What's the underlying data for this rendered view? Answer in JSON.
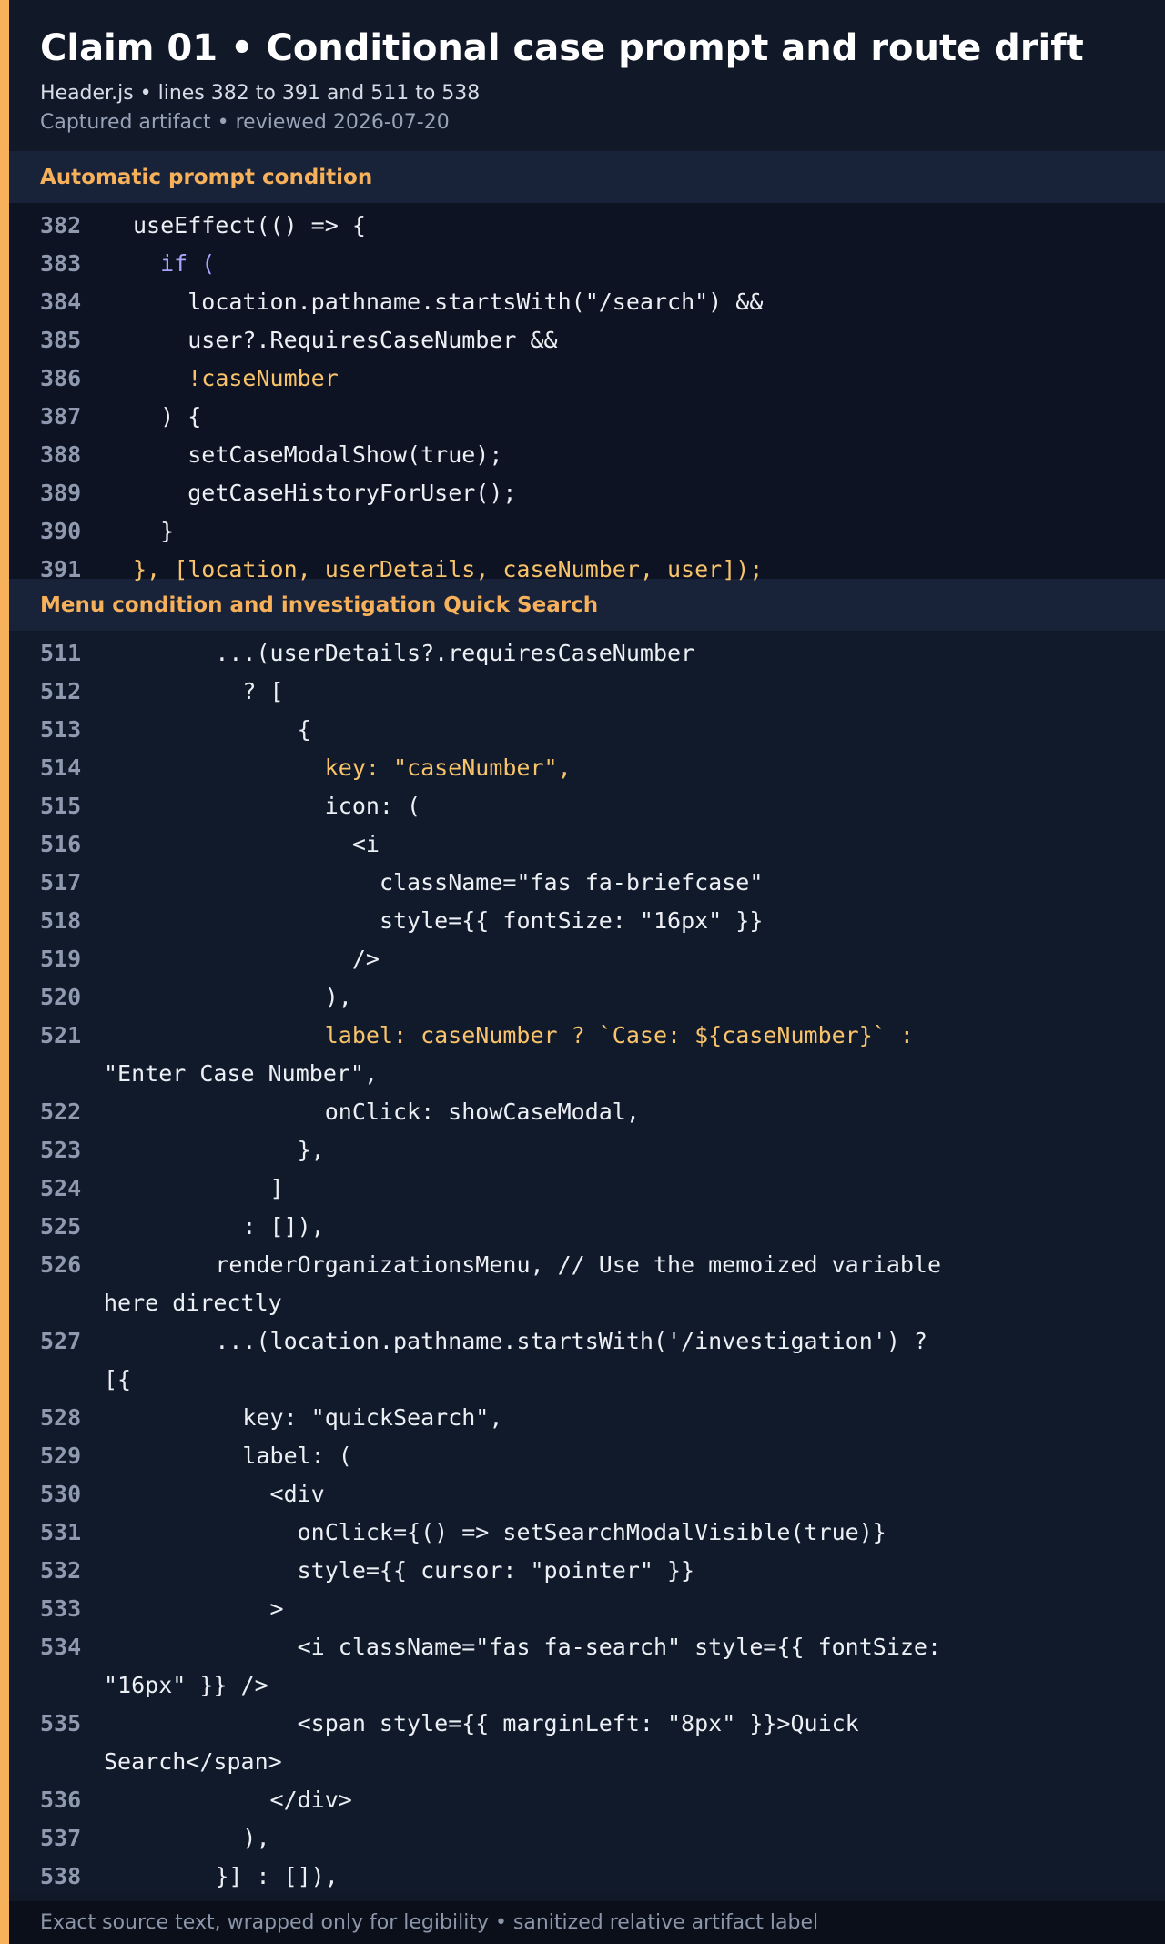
{
  "header": {
    "title": "Claim 01 • Conditional case prompt and route drift",
    "meta_line": "Header.js • lines 382 to 391 and 511 to 538",
    "captured_line": "Captured artifact • reviewed 2026-07-20"
  },
  "colors": {
    "accent": "#f6b15a",
    "background": "#111827",
    "highlight_text": "#f8c36a",
    "keyword_text": "#a6a6ff"
  },
  "sections": [
    {
      "title": "Automatic prompt condition",
      "lines": [
        {
          "num": "382",
          "indent": "",
          "text": "useEffect(() => {",
          "style": ""
        },
        {
          "num": "383",
          "indent": "  ",
          "text": "if (",
          "style": "kw"
        },
        {
          "num": "384",
          "indent": "    ",
          "text": "location.pathname.startsWith(\"/search\") &&",
          "style": ""
        },
        {
          "num": "385",
          "indent": "    ",
          "text": "user?.RequiresCaseNumber &&",
          "style": ""
        },
        {
          "num": "386",
          "indent": "    ",
          "text": "!caseNumber",
          "style": "hl"
        },
        {
          "num": "387",
          "indent": "  ",
          "text": ") {",
          "style": ""
        },
        {
          "num": "388",
          "indent": "    ",
          "text": "setCaseModalShow(true);",
          "style": ""
        },
        {
          "num": "389",
          "indent": "    ",
          "text": "getCaseHistoryForUser();",
          "style": ""
        },
        {
          "num": "390",
          "indent": "  ",
          "text": "}",
          "style": ""
        },
        {
          "num": "391",
          "indent": "",
          "text": "}, [location, userDetails, caseNumber, user]);",
          "style": "hl"
        }
      ]
    },
    {
      "title": "Menu condition and investigation Quick Search",
      "lines": [
        {
          "num": "511",
          "indent": "      ",
          "text": "...(userDetails?.requiresCaseNumber",
          "style": ""
        },
        {
          "num": "512",
          "indent": "        ",
          "text": "? [",
          "style": ""
        },
        {
          "num": "513",
          "indent": "            ",
          "text": "{",
          "style": ""
        },
        {
          "num": "514",
          "indent": "              ",
          "text": "key: \"caseNumber\",",
          "style": "hl"
        },
        {
          "num": "515",
          "indent": "              ",
          "text": "icon: (",
          "style": ""
        },
        {
          "num": "516",
          "indent": "                ",
          "text": "<i",
          "style": ""
        },
        {
          "num": "517",
          "indent": "                  ",
          "text": "className=\"fas fa-briefcase\"",
          "style": ""
        },
        {
          "num": "518",
          "indent": "                  ",
          "text": "style={{ fontSize: \"16px\" }}",
          "style": ""
        },
        {
          "num": "519",
          "indent": "                ",
          "text": "/>",
          "style": ""
        },
        {
          "num": "520",
          "indent": "              ",
          "text": "),",
          "style": ""
        },
        {
          "num": "521",
          "indent": "              ",
          "text": "label: caseNumber ? `Case: ${caseNumber}` :",
          "style": "hl",
          "cont": "\"Enter Case Number\","
        },
        {
          "num": "522",
          "indent": "              ",
          "text": "onClick: showCaseModal,",
          "style": ""
        },
        {
          "num": "523",
          "indent": "            ",
          "text": "},",
          "style": ""
        },
        {
          "num": "524",
          "indent": "          ",
          "text": "]",
          "style": ""
        },
        {
          "num": "525",
          "indent": "        ",
          "text": ": []),",
          "style": ""
        },
        {
          "num": "526",
          "indent": "      ",
          "text": "renderOrganizationsMenu, // Use the memoized variable",
          "style": "",
          "cont": "here directly"
        },
        {
          "num": "527",
          "indent": "      ",
          "text": "...(location.pathname.startsWith('/investigation') ?",
          "style": "",
          "cont": "[{"
        },
        {
          "num": "528",
          "indent": "        ",
          "text": "key: \"quickSearch\",",
          "style": ""
        },
        {
          "num": "529",
          "indent": "        ",
          "text": "label: (",
          "style": ""
        },
        {
          "num": "530",
          "indent": "          ",
          "text": "<div",
          "style": ""
        },
        {
          "num": "531",
          "indent": "            ",
          "text": "onClick={() => setSearchModalVisible(true)}",
          "style": ""
        },
        {
          "num": "532",
          "indent": "            ",
          "text": "style={{ cursor: \"pointer\" }}",
          "style": ""
        },
        {
          "num": "533",
          "indent": "          ",
          "text": ">",
          "style": ""
        },
        {
          "num": "534",
          "indent": "            ",
          "text": "<i className=\"fas fa-search\" style={{ fontSize:",
          "style": "",
          "cont": "\"16px\" }} />"
        },
        {
          "num": "535",
          "indent": "            ",
          "text": "<span style={{ marginLeft: \"8px\" }}>Quick",
          "style": "",
          "cont": "Search</span>"
        },
        {
          "num": "536",
          "indent": "          ",
          "text": "</div>",
          "style": ""
        },
        {
          "num": "537",
          "indent": "        ",
          "text": "),",
          "style": ""
        },
        {
          "num": "538",
          "indent": "      ",
          "text": "}] : []),",
          "style": ""
        }
      ]
    }
  ],
  "footer": {
    "text": "Exact source text, wrapped only for legibility • sanitized relative artifact label"
  }
}
